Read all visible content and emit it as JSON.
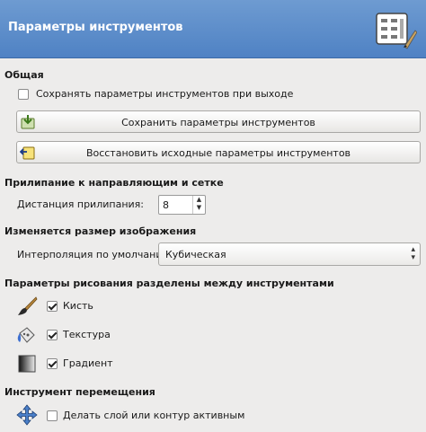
{
  "header": {
    "title": "Параметры инструментов",
    "icon": "tool-options-icon"
  },
  "general": {
    "section_title": "Общая",
    "save_on_exit_label": "Сохранять параметры инструментов при выходе",
    "save_on_exit_checked": false,
    "save_button_label": "Сохранить параметры инструментов",
    "reset_button_label": "Восстановить исходные параметры инструментов"
  },
  "snapping": {
    "section_title": "Прилипание к направляющим и сетке",
    "distance_label": "Дистанция прилипания:",
    "distance_value": "8"
  },
  "scaling": {
    "section_title": "Изменяется размер изображения",
    "interpolation_label": "Интерполяция по умолчанию:",
    "interpolation_value": "Кубическая"
  },
  "paint": {
    "section_title": "Параметры рисования разделены между инструментами",
    "items": [
      {
        "label": "Кисть",
        "checked": true,
        "icon": "brush-icon"
      },
      {
        "label": "Текстура",
        "checked": true,
        "icon": "pattern-icon"
      },
      {
        "label": "Градиент",
        "checked": true,
        "icon": "gradient-icon"
      }
    ]
  },
  "move": {
    "section_title": "Инструмент перемещения",
    "label": "Делать слой или контур активным",
    "checked": false,
    "icon": "move-tool-icon"
  }
}
